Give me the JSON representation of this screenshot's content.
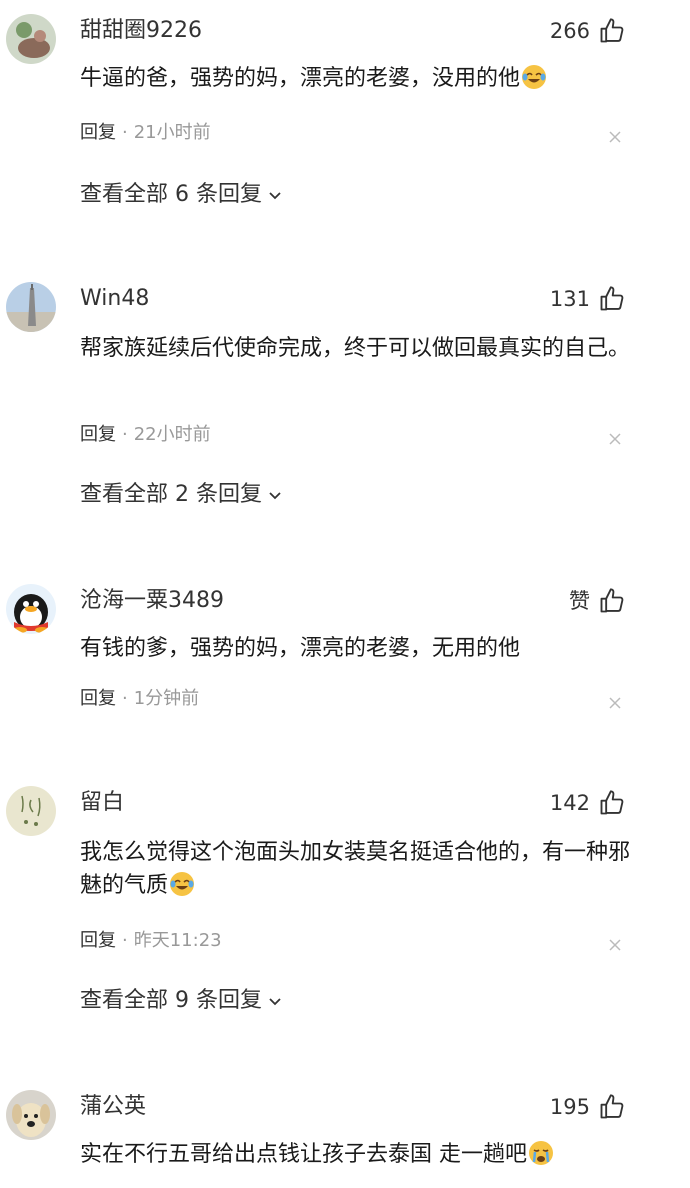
{
  "comments": [
    {
      "username": "甜甜圈9226",
      "likes": "266",
      "text": "牛逼的爸，强势的妈，漂亮的老婆，没用的他",
      "emoji": "laugh-cry-emoji",
      "reply_label": "回复",
      "time": "21小时前",
      "view_replies": "查看全部 6 条回复"
    },
    {
      "username": "Win48",
      "likes": "131",
      "text": "帮家族延续后代使命完成，终于可以做回最真实的自己。",
      "emoji": "",
      "reply_label": "回复",
      "time": "22小时前",
      "view_replies": "查看全部 2 条回复"
    },
    {
      "username": "沧海一粟3489",
      "likes": "赞",
      "text": "有钱的爹，强势的妈，漂亮的老婆，无用的他",
      "emoji": "",
      "reply_label": "回复",
      "time": "1分钟前",
      "view_replies": ""
    },
    {
      "username": "留白",
      "likes": "142",
      "text": "我怎么觉得这个泡面头加女装莫名挺适合他的，有一种邪魅的气质",
      "emoji": "laugh-cry-emoji",
      "reply_label": "回复",
      "time": "昨天11:23",
      "view_replies": "查看全部 9 条回复"
    },
    {
      "username": "蒲公英",
      "likes": "195",
      "text": "实在不行五哥给出点钱让孩子去泰国 走一趟吧",
      "emoji": "crying-emoji",
      "reply_label": "",
      "time": "",
      "view_replies": ""
    }
  ],
  "separator": "·",
  "colors": {
    "text": "#1a1a1a",
    "muted": "#999999",
    "username": "#333333"
  }
}
